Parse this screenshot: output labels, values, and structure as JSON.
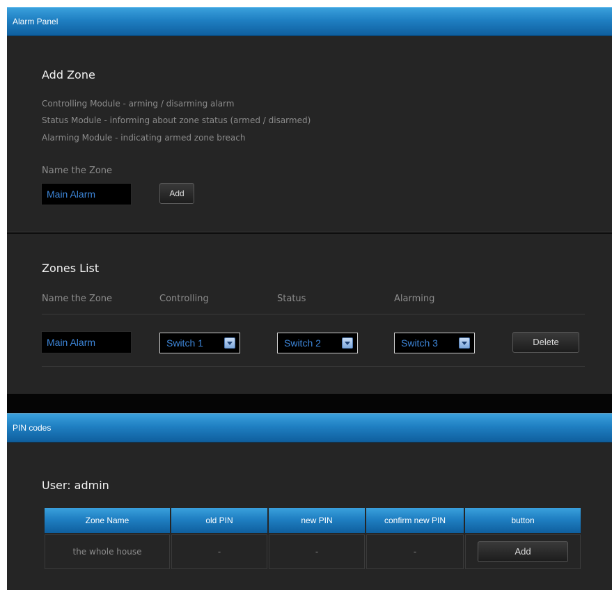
{
  "alarm_panel": {
    "header": "Alarm Panel",
    "add_zone": {
      "title": "Add Zone",
      "descriptions": [
        "Controlling Module - arming / disarming alarm",
        "Status Module - informing about zone status (armed / disarmed)",
        "Alarming Module - indicating armed zone breach"
      ],
      "name_label": "Name the Zone",
      "name_value": "Main Alarm",
      "add_label": "Add"
    },
    "zones_list": {
      "title": "Zones List",
      "columns": [
        "Name the Zone",
        "Controlling",
        "Status",
        "Alarming"
      ],
      "rows": [
        {
          "name": "Main Alarm",
          "controlling": "Switch 1",
          "status": "Switch 2",
          "alarming": "Switch 3",
          "delete_label": "Delete"
        }
      ]
    }
  },
  "pin_codes": {
    "header": "PIN codes",
    "user_label": "User: admin",
    "table": {
      "headers": [
        "Zone Name",
        "old PIN",
        "new PIN",
        "confirm new PIN",
        "button"
      ],
      "rows": [
        {
          "zone_name": "the whole house",
          "old_pin": "-",
          "new_pin": "-",
          "confirm_pin": "-",
          "button_label": "Add"
        }
      ]
    }
  },
  "colors": {
    "header_blue": "#1f7fc2",
    "panel_bg": "#252525",
    "input_text": "#3d86d9"
  }
}
